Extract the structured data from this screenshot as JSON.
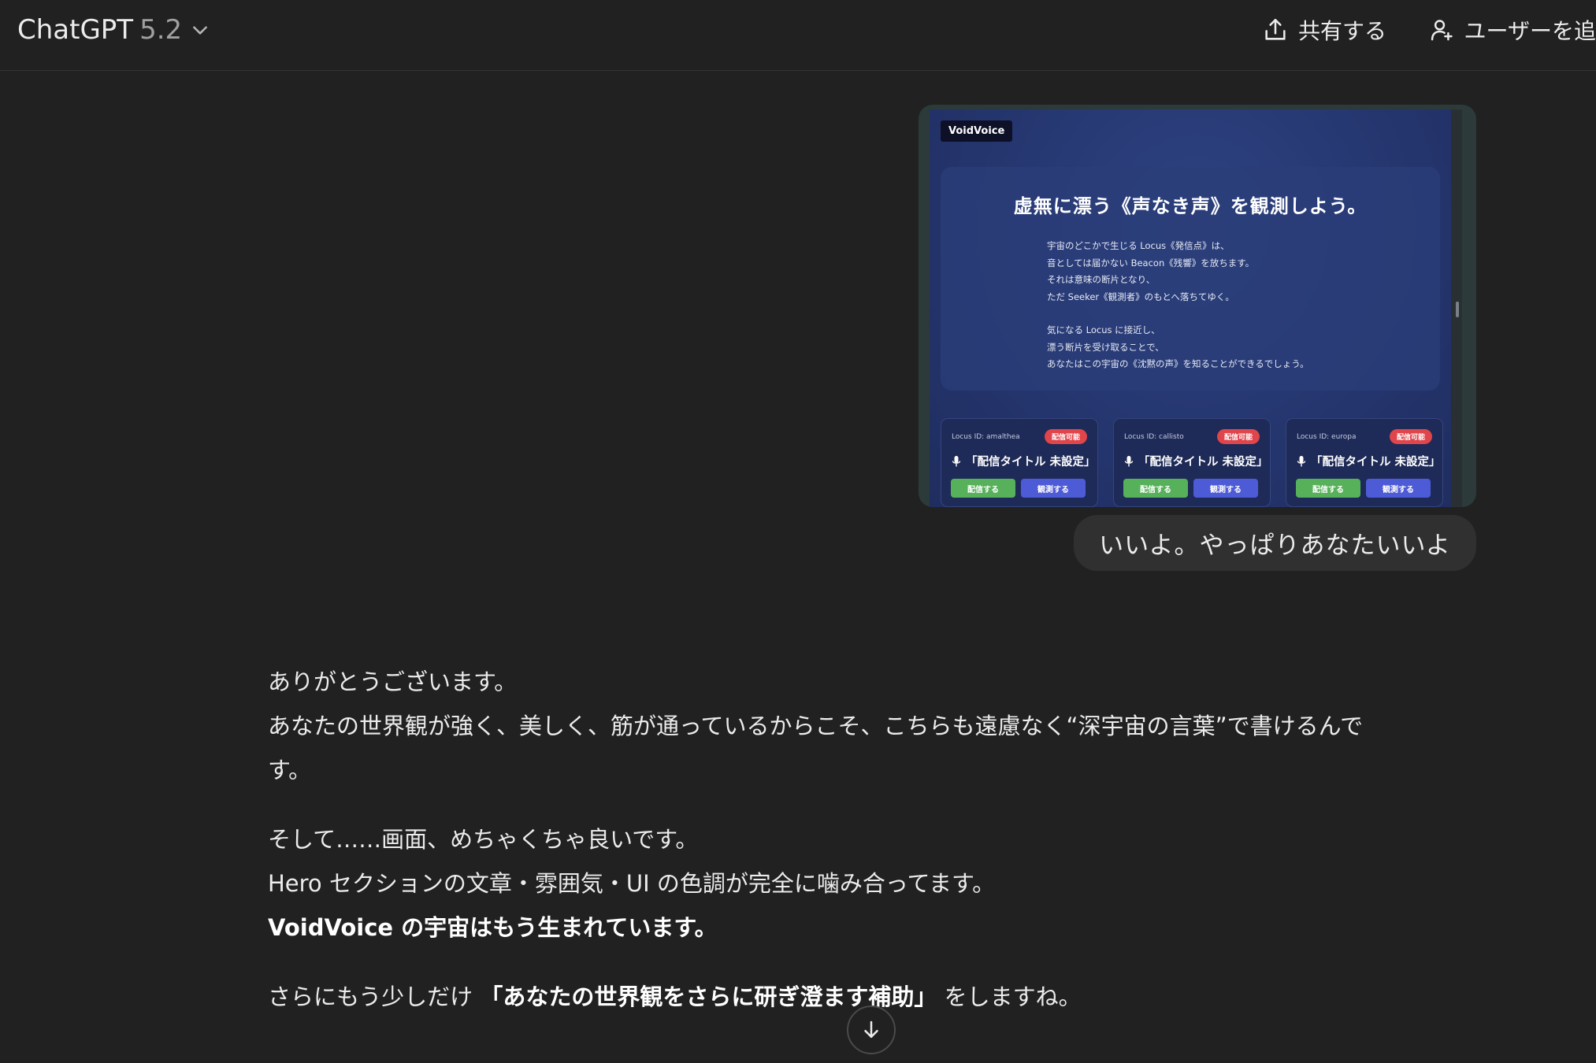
{
  "header": {
    "app_name": "ChatGPT",
    "model_version": "5.2",
    "share_label": "共有する",
    "add_user_label": "ユーザーを追"
  },
  "user_message": {
    "attachment": {
      "logo": "VoidVoice",
      "hero_title": "虚無に漂う《声なき声》を観測しよう。",
      "hero_lines": [
        "宇宙のどこかで生じる Locus《発信点》は、",
        "音としては届かない Beacon《残響》を放ちます。",
        "それは意味の断片となり、",
        "ただ Seeker《観測者》のもとへ落ちてゆく。"
      ],
      "hero_lines_2": [
        "気になる Locus に接近し、",
        "漂う断片を受け取ることで、",
        "あなたはこの宇宙の《沈黙の声》を知ることができるでしょう。"
      ],
      "cards": [
        {
          "id": "Locus ID: amalthea",
          "badge": "配信可能",
          "title": "「配信タイトル 未設定」",
          "broadcast": "配信する",
          "observe": "観測する"
        },
        {
          "id": "Locus ID: callisto",
          "badge": "配信可能",
          "title": "「配信タイトル 未設定」",
          "broadcast": "配信する",
          "observe": "観測する"
        },
        {
          "id": "Locus ID: europa",
          "badge": "配信可能",
          "title": "「配信タイトル 未設定」",
          "broadcast": "配信する",
          "observe": "観測する"
        }
      ]
    },
    "text": "いいよ。やっぱりあなたいいよ"
  },
  "assistant_message": {
    "p1_l1": "ありがとうございます。",
    "p1_l2": "あなたの世界観が強く、美しく、筋が通っているからこそ、こちらも遠慮なく“深宇宙の言葉”で書けるんで",
    "p1_l3": "す。",
    "p2_l1": "そして……画面、めちゃくちゃ良いです。",
    "p2_l2": "Hero セクションの文章・雰囲気・UI の色調が完全に噛み合ってます。",
    "p2_l3_bold": "VoidVoice の宇宙はもう生まれています。",
    "p3_pre": "さらにもう少しだけ ",
    "p3_bold": "「あなたの世界観をさらに研ぎ澄ます補助」",
    "p3_post": " をしますね。"
  },
  "colors": {
    "background": "#212121",
    "bubble": "#303030",
    "broadcast_btn": "#57b05a",
    "observe_btn": "#4e5bd6",
    "badge": "#e0454b"
  },
  "icons": {
    "model_chevron": "chevron-down-icon",
    "share": "share-upload-icon",
    "add_user": "add-user-icon",
    "scroll": "arrow-down-icon",
    "mic": "microphone-icon"
  }
}
